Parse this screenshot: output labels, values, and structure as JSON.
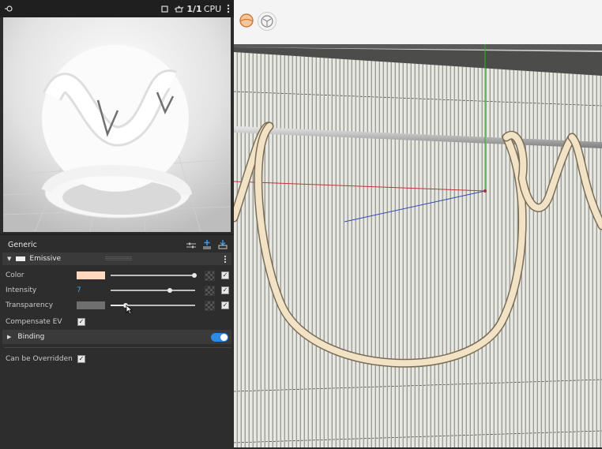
{
  "toolbar": {
    "ratio_label": "1/1",
    "engine_label": "CPU",
    "icons": [
      "pin-icon",
      "stop-icon",
      "teapot-icon",
      "more-vertical-icon"
    ]
  },
  "viewport_toolbar": {
    "icons": [
      "material-sphere-icon",
      "wireframe-sphere-icon"
    ]
  },
  "props": {
    "section_title": "Generic",
    "layer": {
      "name": "Emissive",
      "swatch_color": "#eeeeee"
    },
    "color": {
      "label": "Color",
      "swatch": "#ffd9bf",
      "level": 0.98
    },
    "intensity": {
      "label": "Intensity",
      "value": "7",
      "level": 0.69
    },
    "transparency": {
      "label": "Transparency",
      "swatch": "#6f6f6f",
      "level": 0.18
    },
    "compensate_ev": {
      "label": "Compensate EV",
      "checked": true
    },
    "binding": {
      "label": "Binding",
      "toggle_on": true
    },
    "can_override": {
      "label": "Can be Overridden",
      "checked": true
    }
  },
  "colors": {
    "accent": "#2e8ae6",
    "intensity_value": "#4aa3df",
    "rope": "#f3e3c6"
  }
}
